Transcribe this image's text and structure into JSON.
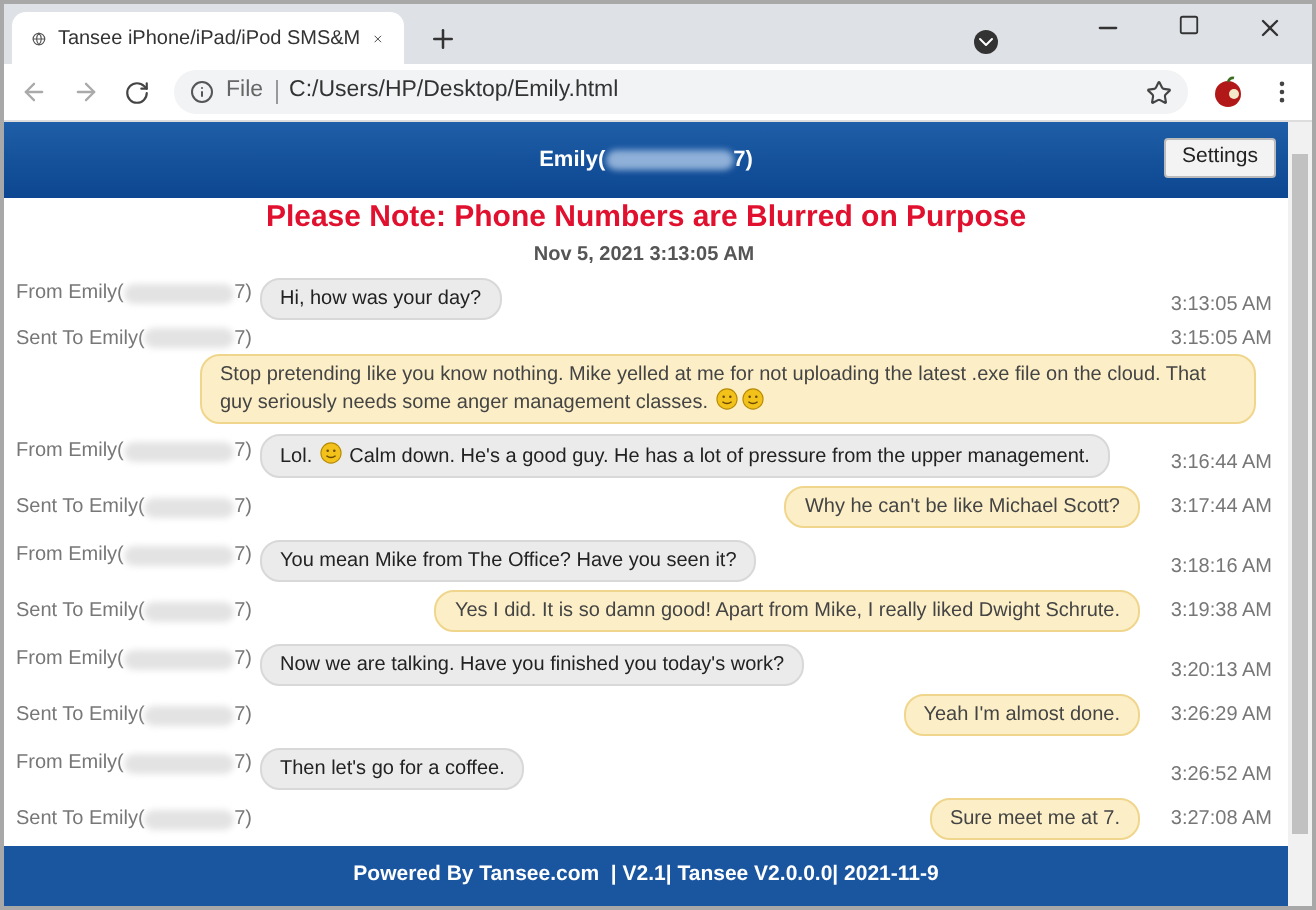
{
  "browser": {
    "tab_title": "Tansee iPhone/iPad/iPod SMS&M",
    "address_scheme": "File",
    "address": "C:/Users/HP/Desktop/Emily.html"
  },
  "header": {
    "title_prefix": "Emily(",
    "title_suffix": "7)",
    "settings_button": "Settings"
  },
  "note": "Please Note: Phone Numbers are Blurred on Purpose",
  "date": "Nov 5, 2021 3:13:05 AM",
  "messages": [
    {
      "kind": "in",
      "label": "From Emily(",
      "label_end": "7)",
      "time": "3:13:05 AM",
      "parts": [
        {
          "kind": "text",
          "text": "Hi, how was your day?"
        }
      ]
    },
    {
      "kind": "out-wide",
      "label": "Sent To Emily(",
      "label_end": "7)",
      "time": "3:15:05 AM",
      "parts": [
        {
          "kind": "text",
          "text": "Stop pretending like you know nothing. Mike yelled at me for not uploading the latest .exe file on the cloud. That guy seriously needs some anger management classes. "
        },
        {
          "kind": "emoji"
        },
        {
          "kind": "emoji"
        }
      ]
    },
    {
      "kind": "in",
      "label": "From Emily(",
      "label_end": "7)",
      "time": "3:16:44 AM",
      "parts": [
        {
          "kind": "text",
          "text": "Lol. "
        },
        {
          "kind": "emoji"
        },
        {
          "kind": "text",
          "text": " Calm down. He's a good guy. He has a lot of pressure from the upper management."
        }
      ]
    },
    {
      "kind": "out",
      "label": "Sent To Emily(",
      "label_end": "7)",
      "time": "3:17:44 AM",
      "parts": [
        {
          "kind": "text",
          "text": "Why he can't be like Michael Scott?"
        }
      ]
    },
    {
      "kind": "in",
      "label": "From Emily(",
      "label_end": "7)",
      "time": "3:18:16 AM",
      "parts": [
        {
          "kind": "text",
          "text": "You mean Mike from The Office? Have you seen it?"
        }
      ]
    },
    {
      "kind": "out",
      "label": "Sent To Emily(",
      "label_end": "7)",
      "time": "3:19:38 AM",
      "parts": [
        {
          "kind": "text",
          "text": "Yes I did. It is so damn good! Apart from Mike, I really liked Dwight Schrute."
        }
      ]
    },
    {
      "kind": "in",
      "label": "From Emily(",
      "label_end": "7)",
      "time": "3:20:13 AM",
      "parts": [
        {
          "kind": "text",
          "text": "Now we are talking. Have you finished you today's work?"
        }
      ]
    },
    {
      "kind": "out",
      "label": "Sent To Emily(",
      "label_end": "7)",
      "time": "3:26:29 AM",
      "parts": [
        {
          "kind": "text",
          "text": "Yeah I'm almost done."
        }
      ]
    },
    {
      "kind": "in",
      "label": "From Emily(",
      "label_end": "7)",
      "time": "3:26:52 AM",
      "parts": [
        {
          "kind": "text",
          "text": "Then let's go for a coffee."
        }
      ]
    },
    {
      "kind": "out",
      "label": "Sent To Emily(",
      "label_end": "7)",
      "time": "3:27:08 AM",
      "parts": [
        {
          "kind": "text",
          "text": "Sure meet me at 7."
        }
      ]
    }
  ],
  "footer": "Powered By Tansee.com  | V2.1| Tansee V2.0.0.0| 2021-11-9"
}
